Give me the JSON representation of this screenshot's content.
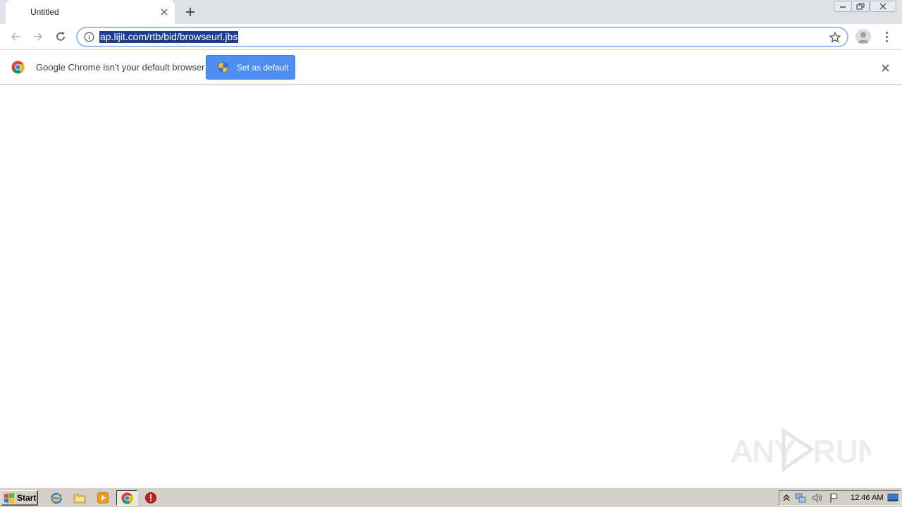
{
  "tabs": [
    {
      "title": "Untitled"
    }
  ],
  "omnibox": {
    "url": "ap.lijit.com/rtb/bid/browseurl.jbs"
  },
  "infobar": {
    "message": "Google Chrome isn't your default browser",
    "button_label": "Set as default"
  },
  "watermark": {
    "text_left": "ANY",
    "text_right": "RUN"
  },
  "taskbar": {
    "start_label": "Start",
    "clock": "12:46 AM"
  },
  "colors": {
    "tabstrip": "#dee1e6",
    "url_selection": "#1b3c8f",
    "button_blue": "#4d8ef0",
    "taskbar": "#d4d0c8"
  },
  "icons": {
    "taskbar": [
      "ie-icon",
      "explorer-folder-icon",
      "media-player-icon",
      "chrome-icon",
      "stop-icon"
    ],
    "tray": [
      "chevron-up-icon",
      "network-icon",
      "volume-icon",
      "flag-icon",
      "show-desktop-icon"
    ]
  }
}
